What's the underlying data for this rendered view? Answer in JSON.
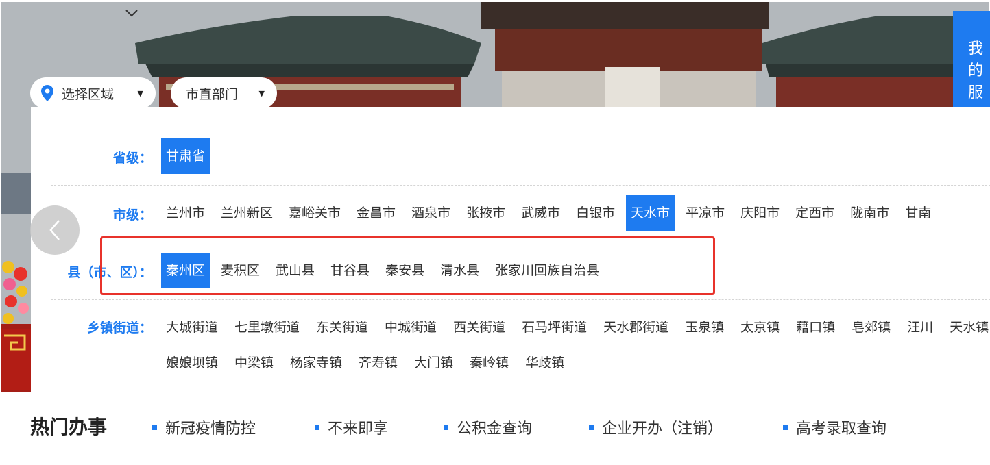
{
  "side_tab": {
    "chars": [
      "我",
      "的",
      "服"
    ]
  },
  "selectors": {
    "region_label": "选择区域",
    "dept_label": "市直部门"
  },
  "rows": {
    "province": {
      "label": "省级：",
      "items": [
        {
          "label": "甘肃省",
          "active": true
        }
      ]
    },
    "city": {
      "label": "市级：",
      "items": [
        {
          "label": "兰州市",
          "active": false
        },
        {
          "label": "兰州新区",
          "active": false
        },
        {
          "label": "嘉峪关市",
          "active": false
        },
        {
          "label": "金昌市",
          "active": false
        },
        {
          "label": "酒泉市",
          "active": false
        },
        {
          "label": "张掖市",
          "active": false
        },
        {
          "label": "武威市",
          "active": false
        },
        {
          "label": "白银市",
          "active": false
        },
        {
          "label": "天水市",
          "active": true
        },
        {
          "label": "平凉市",
          "active": false
        },
        {
          "label": "庆阳市",
          "active": false
        },
        {
          "label": "定西市",
          "active": false
        },
        {
          "label": "陇南市",
          "active": false
        },
        {
          "label": "甘南",
          "active": false
        }
      ]
    },
    "county": {
      "label": "县（市、区）：",
      "items": [
        {
          "label": "秦州区",
          "active": true
        },
        {
          "label": "麦积区",
          "active": false
        },
        {
          "label": "武山县",
          "active": false
        },
        {
          "label": "甘谷县",
          "active": false
        },
        {
          "label": "秦安县",
          "active": false
        },
        {
          "label": "清水县",
          "active": false
        },
        {
          "label": "张家川回族自治县",
          "active": false
        }
      ]
    },
    "town": {
      "label": "乡镇街道：",
      "items": [
        {
          "label": "大城街道",
          "active": false
        },
        {
          "label": "七里墩街道",
          "active": false
        },
        {
          "label": "东关街道",
          "active": false
        },
        {
          "label": "中城街道",
          "active": false
        },
        {
          "label": "西关街道",
          "active": false
        },
        {
          "label": "石马坪街道",
          "active": false
        },
        {
          "label": "天水郡街道",
          "active": false
        },
        {
          "label": "玉泉镇",
          "active": false
        },
        {
          "label": "太京镇",
          "active": false
        },
        {
          "label": "藉口镇",
          "active": false
        },
        {
          "label": "皂郊镇",
          "active": false
        },
        {
          "label": "汪川",
          "active": false
        },
        {
          "label": "天水镇",
          "active": false
        },
        {
          "label": "娘娘坝镇",
          "active": false
        },
        {
          "label": "中梁镇",
          "active": false
        },
        {
          "label": "杨家寺镇",
          "active": false
        },
        {
          "label": "齐寿镇",
          "active": false
        },
        {
          "label": "大门镇",
          "active": false
        },
        {
          "label": "秦岭镇",
          "active": false
        },
        {
          "label": "华歧镇",
          "active": false
        }
      ]
    }
  },
  "hot": {
    "title": "热门办事",
    "items": [
      "新冠疫情防控",
      "不来即享",
      "公积金查询",
      "企业开办（注销）",
      "高考录取查询"
    ]
  },
  "colors": {
    "accent": "#1e7bf0",
    "highlight": "#e8322b"
  },
  "icons": {
    "region": "location-pin-icon",
    "dropdown": "caret-down-icon",
    "prev": "chevron-left-icon"
  }
}
